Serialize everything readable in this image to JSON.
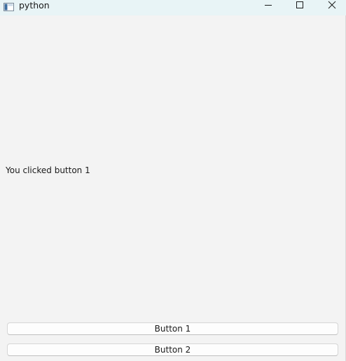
{
  "window": {
    "title": "python",
    "icon": "python-window-icon",
    "controls": [
      "minimize-icon",
      "maximize-icon",
      "close-icon"
    ]
  },
  "content": {
    "message": "You clicked button 1"
  },
  "buttons": [
    {
      "label": "Button 1"
    },
    {
      "label": "Button 2"
    }
  ]
}
